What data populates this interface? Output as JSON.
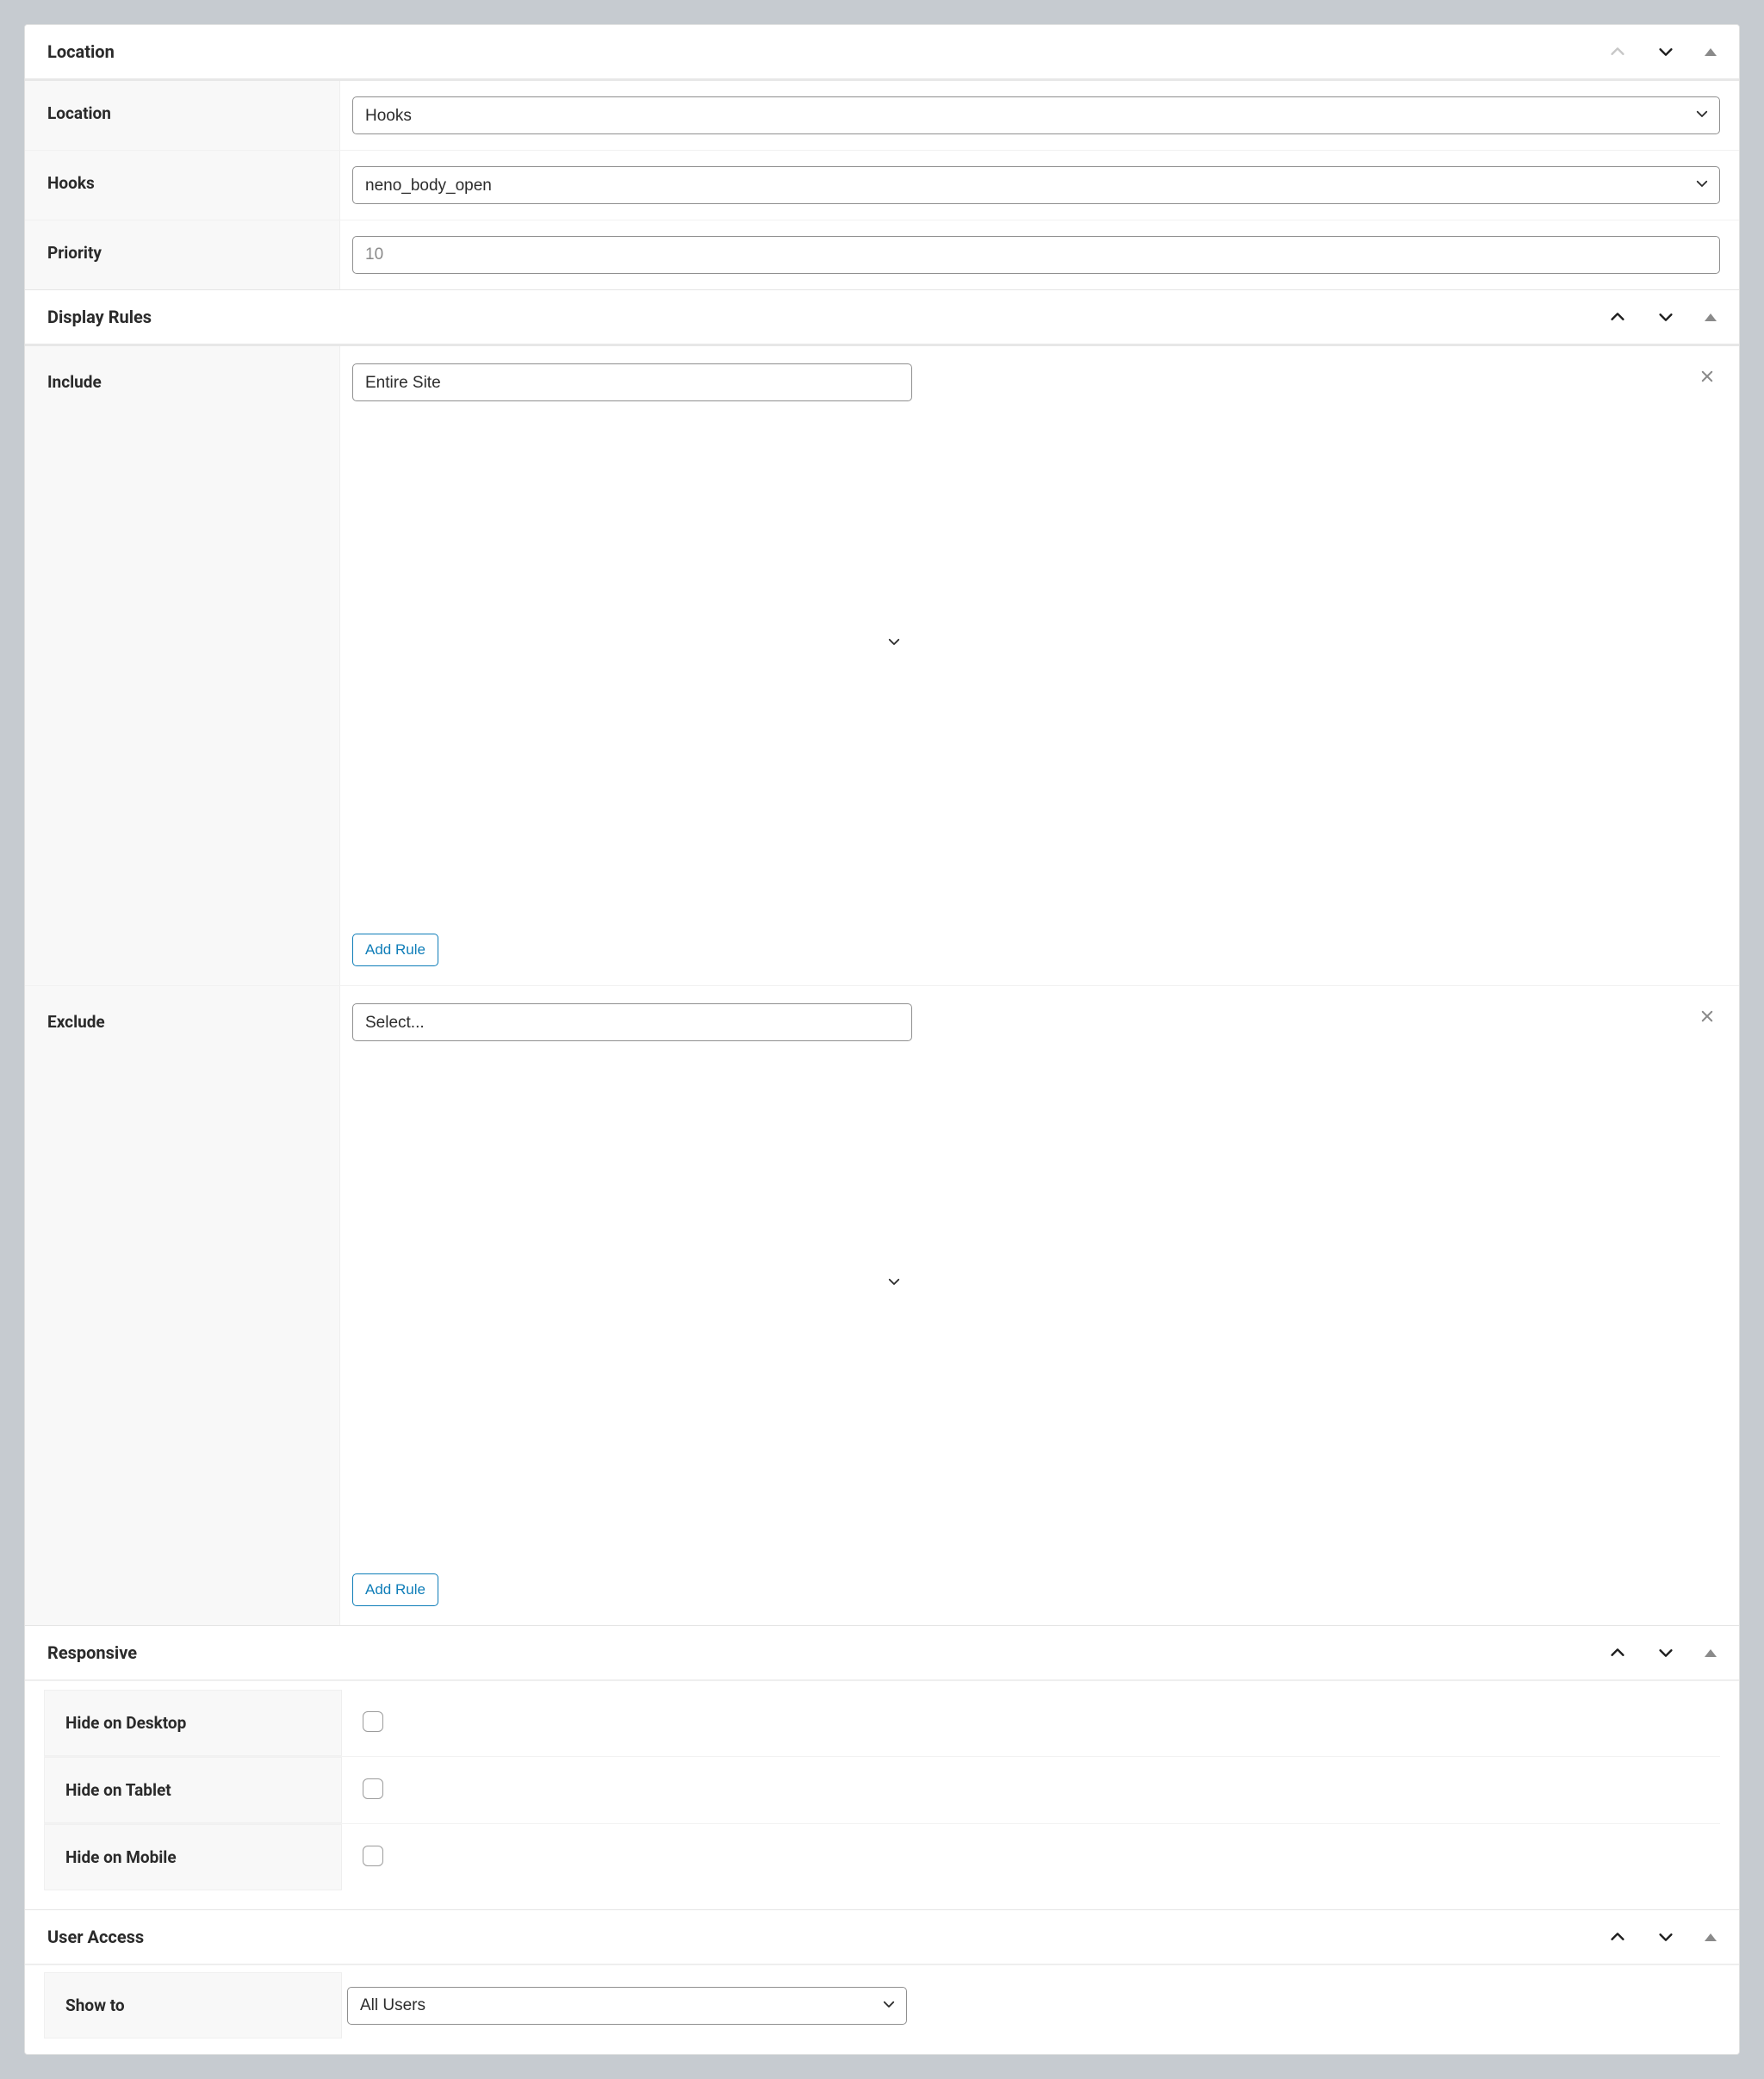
{
  "sections": {
    "location": {
      "title": "Location"
    },
    "display_rules": {
      "title": "Display Rules"
    },
    "responsive": {
      "title": "Responsive"
    },
    "user_access": {
      "title": "User Access"
    }
  },
  "location": {
    "label": "Location",
    "value": "Hooks"
  },
  "hooks": {
    "label": "Hooks",
    "value": "neno_body_open"
  },
  "priority": {
    "label": "Priority",
    "placeholder": "10",
    "value": ""
  },
  "include": {
    "label": "Include",
    "value": "Entire Site",
    "add_rule": "Add Rule"
  },
  "exclude": {
    "label": "Exclude",
    "value": "Select...",
    "add_rule": "Add Rule"
  },
  "responsive": {
    "hide_desktop": {
      "label": "Hide on Desktop",
      "checked": false
    },
    "hide_tablet": {
      "label": "Hide on Tablet",
      "checked": false
    },
    "hide_mobile": {
      "label": "Hide on Mobile",
      "checked": false
    }
  },
  "user_access": {
    "show_to": {
      "label": "Show to",
      "value": "All Users"
    }
  }
}
